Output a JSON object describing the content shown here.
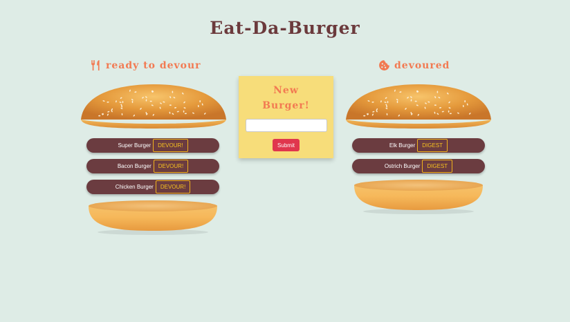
{
  "header": {
    "title": "Eat-Da-Burger"
  },
  "ready": {
    "heading": "ready to devour",
    "icon": "fork-knife-icon",
    "button_label": "DEVOUR!",
    "burgers": [
      "Super Burger",
      "Bacon Burger",
      "Chicken Burger"
    ]
  },
  "devoured": {
    "heading": "devoured",
    "icon": "cookie-icon",
    "button_label": "DIGEST",
    "burgers": [
      "Elk Burger",
      "Ostrich Burger"
    ]
  },
  "new_burger": {
    "title_line1": "New",
    "title_line2": "Burger!",
    "input_value": "",
    "input_placeholder": "",
    "submit_label": "Submit"
  },
  "colors": {
    "background": "#deece6",
    "title": "#6b3a3c",
    "accent": "#f27a52",
    "row": "#6b3c40",
    "button_text": "#f7c21f",
    "card": "#f7dd7a",
    "submit": "#e0364d"
  }
}
